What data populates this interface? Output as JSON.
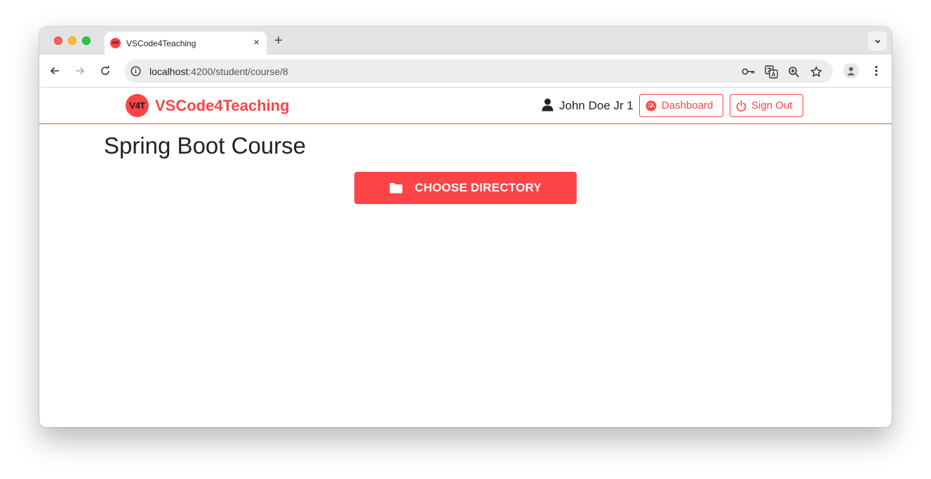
{
  "browser": {
    "tab": {
      "favicon_text": "V4T",
      "title": "VSCode4Teaching",
      "close_glyph": "×"
    },
    "new_tab_glyph": "+",
    "address_bar": {
      "host": "localhost",
      "path": ":4200/student/course/8"
    }
  },
  "header": {
    "logo_text": "V4T",
    "brand": "VSCode4Teaching",
    "user_name": "John Doe Jr 1",
    "dashboard_label": "Dashboard",
    "signout_label": "Sign Out"
  },
  "main": {
    "title": "Spring Boot Course",
    "choose_directory_label": "CHOOSE DIRECTORY"
  },
  "icons": {
    "user": "user-icon",
    "dashboard": "gauge-icon",
    "signout": "power-icon",
    "choose_directory": "folder-icon"
  },
  "colors": {
    "accent": "#ff4447",
    "header_border": "#e84a4a",
    "title_text": "#222222"
  }
}
